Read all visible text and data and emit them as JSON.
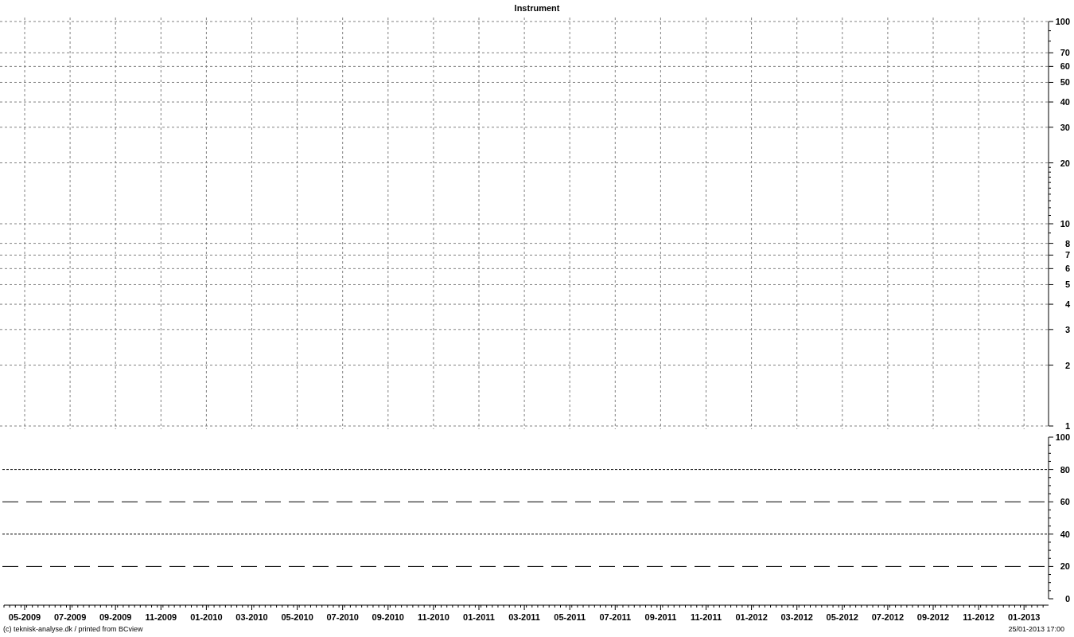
{
  "price_chart": {
    "title": "Instrument",
    "grid": true,
    "y_axis_labels": [
      "100",
      "70",
      "60",
      "50",
      "40",
      "30",
      "20",
      "10",
      "8",
      "7",
      "6",
      "5",
      "4",
      "3",
      "2",
      "1"
    ]
  },
  "indicator_chart": {
    "reference_lines": true,
    "y_axis_labels": [
      "100",
      "80",
      "60",
      "40",
      "20",
      "0"
    ],
    "x_axis_labels": [
      "05-2009",
      "07-2009",
      "09-2009",
      "11-2009",
      "01-2010",
      "03-2010",
      "05-2010",
      "07-2010",
      "09-2010",
      "11-2010",
      "01-2011",
      "03-2011",
      "05-2011",
      "07-2011",
      "09-2011",
      "11-2011",
      "01-2012",
      "03-2012",
      "05-2012",
      "07-2012",
      "09-2012",
      "11-2012",
      "01-2013"
    ]
  },
  "footer": {
    "copyright": "(c) teknisk-analyse.dk / printed from BCview",
    "timestamp": "25/01-2013 17:00"
  }
}
